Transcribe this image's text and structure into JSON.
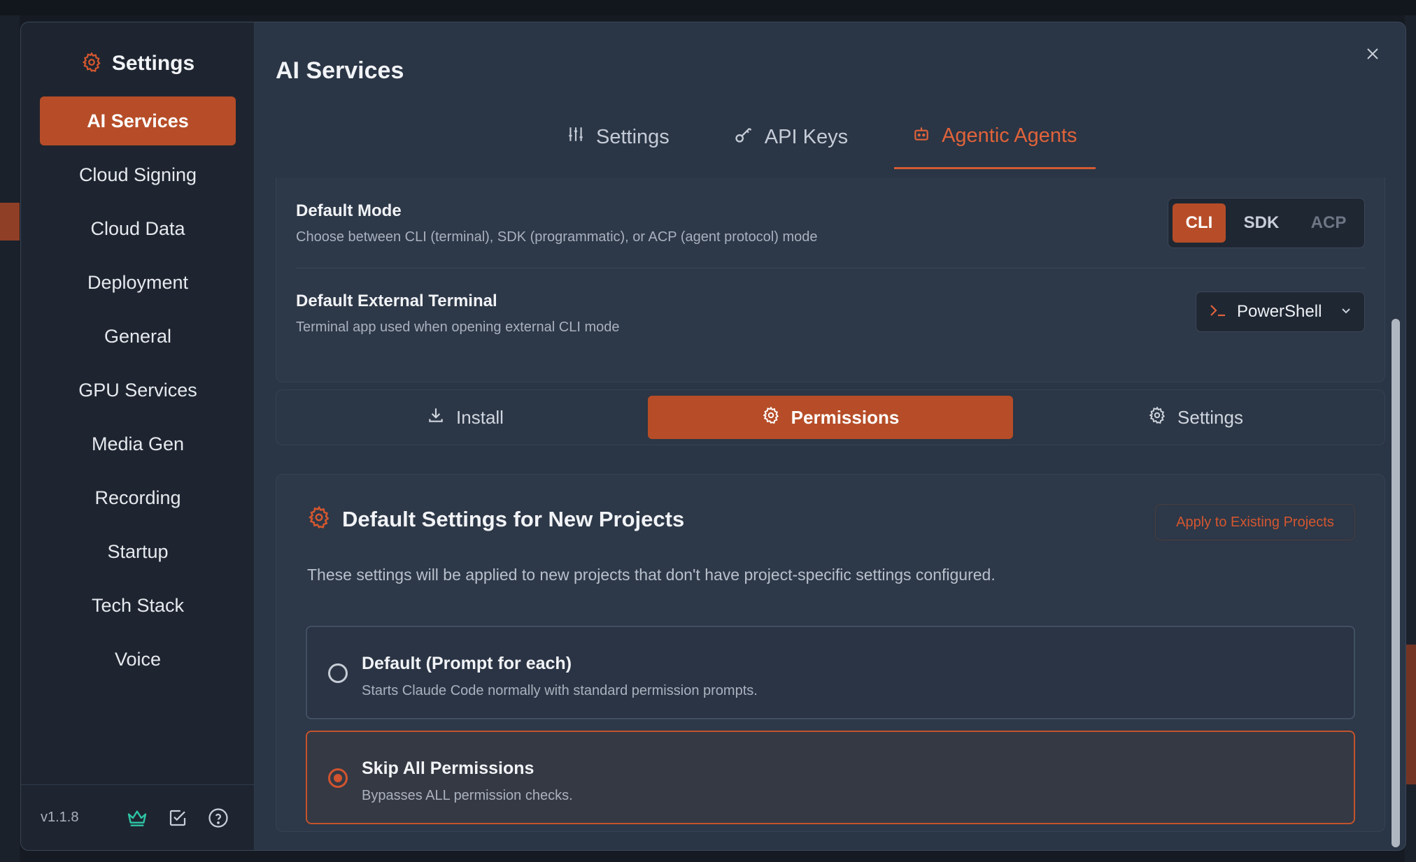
{
  "sidebar": {
    "title": "Settings",
    "items": [
      {
        "label": "AI Services",
        "active": true
      },
      {
        "label": "Cloud Signing"
      },
      {
        "label": "Cloud Data"
      },
      {
        "label": "Deployment"
      },
      {
        "label": "General"
      },
      {
        "label": "GPU Services"
      },
      {
        "label": "Media Gen"
      },
      {
        "label": "Recording"
      },
      {
        "label": "Startup"
      },
      {
        "label": "Tech Stack"
      },
      {
        "label": "Voice"
      }
    ],
    "version": "v1.1.8",
    "footer_icons": [
      "crown-icon",
      "checkbox-icon",
      "help-icon"
    ]
  },
  "main": {
    "title": "AI Services",
    "tabs": [
      {
        "label": "Settings",
        "icon": "sliders-icon"
      },
      {
        "label": "API Keys",
        "icon": "key-icon"
      },
      {
        "label": "Agentic Agents",
        "icon": "robot-icon",
        "active": true
      }
    ]
  },
  "default_mode": {
    "label": "Default Mode",
    "description": "Choose between CLI (terminal), SDK (programmatic), or ACP (agent protocol) mode",
    "options": [
      "CLI",
      "SDK",
      "ACP"
    ],
    "selected": "CLI"
  },
  "external_terminal": {
    "label": "Default External Terminal",
    "description": "Terminal app used when opening external CLI mode",
    "value": "PowerShell"
  },
  "subtabs": [
    {
      "label": "Install",
      "icon": "download-icon"
    },
    {
      "label": "Permissions",
      "icon": "gear-icon",
      "active": true
    },
    {
      "label": "Settings",
      "icon": "gear-icon"
    }
  ],
  "permissions": {
    "title": "Default Settings for New Projects",
    "apply_button": "Apply to Existing Projects",
    "description": "These settings will be applied to new projects that don't have project-specific settings configured.",
    "options": [
      {
        "title": "Default (Prompt for each)",
        "description": "Starts Claude Code normally with standard permission prompts.",
        "selected": false
      },
      {
        "title": "Skip All Permissions",
        "description": "Bypasses ALL permission checks.",
        "selected": true
      }
    ]
  },
  "colors": {
    "accent": "#b64d28",
    "accent_text": "#e0633a",
    "panel": "#2a3545",
    "sidebar": "#1e2530"
  }
}
